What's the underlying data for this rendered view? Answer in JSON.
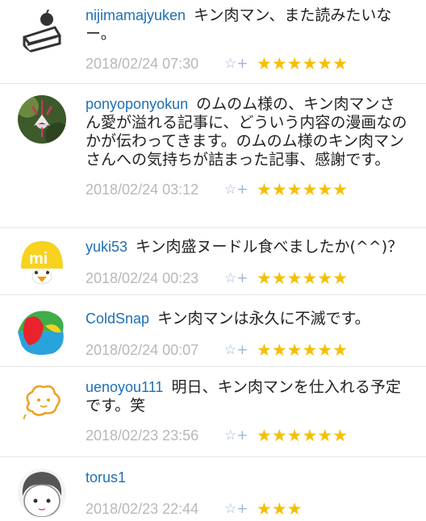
{
  "comments": [
    {
      "user": "nijimamajyuken",
      "text": "キン肉マン、また読みたいなー。",
      "date": "2018/02/24 07:30",
      "stars": "★★★★★★",
      "star_add": "☆+",
      "avatar": "cake-icon"
    },
    {
      "user": "ponyoponyokun",
      "text": "のムのム様の、キン肉マンさん愛が溢れる記事に、どういう内容の漫画なのかが伝わってきます。のムのム様のキン肉マンさんへの気持ちが詰まった記事、感謝です。",
      "date": "2018/02/24 03:12",
      "stars": "★★★★★★",
      "star_add": "☆+",
      "avatar": "flower-icon"
    },
    {
      "user": "yuki53",
      "text": "キン肉盛ヌードル食べましたか(^^)？",
      "date": "2018/02/24 00:23",
      "stars": "★★★★★★",
      "star_add": "☆+",
      "avatar": "chick-icon"
    },
    {
      "user": "ColdSnap",
      "text": "キン肉マンは永久に不滅です。",
      "date": "2018/02/24 00:07",
      "stars": "★★★★★★",
      "star_add": "☆+",
      "avatar": "colorful-blob-icon"
    },
    {
      "user": "uenoyou111",
      "text": "明日、キン肉マンを仕入れる予定です。笑",
      "date": "2018/02/23 23:56",
      "stars": "★★★★★★",
      "star_add": "☆+",
      "avatar": "cloud-character-icon"
    },
    {
      "user": "torus1",
      "text": "",
      "date": "2018/02/23 22:44",
      "stars": "★★★",
      "star_add": "☆+",
      "avatar": "boy-face-icon"
    }
  ]
}
